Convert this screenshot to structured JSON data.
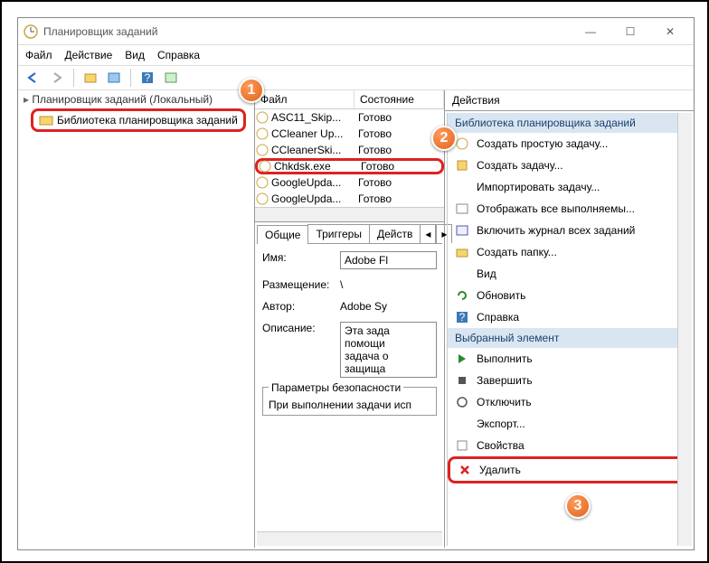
{
  "window": {
    "title": "Планировщик заданий",
    "min": "—",
    "max": "☐",
    "close": "✕"
  },
  "menu": {
    "file": "Файл",
    "action": "Действие",
    "view": "Вид",
    "help": "Справка"
  },
  "tree": {
    "root": "Планировщик заданий (Локальный)",
    "lib": "Библиотека планировщика заданий"
  },
  "tasks": {
    "col_file": "Файл",
    "col_status": "Состояние",
    "rows": [
      {
        "name": "ASC11_Skip...",
        "status": "Готово"
      },
      {
        "name": "CCleaner Up...",
        "status": "Готово"
      },
      {
        "name": "CCleanerSki...",
        "status": "Готово"
      },
      {
        "name": "Chkdsk.exe",
        "status": "Готово"
      },
      {
        "name": "GoogleUpda...",
        "status": "Готово"
      },
      {
        "name": "GoogleUpda...",
        "status": "Готово"
      }
    ]
  },
  "details": {
    "tab_general": "Общие",
    "tab_triggers": "Триггеры",
    "tab_actions": "Действ",
    "lbl_name": "Имя:",
    "val_name": "Adobe Fl",
    "lbl_location": "Размещение:",
    "val_location": "\\",
    "lbl_author": "Автор:",
    "val_author": "Adobe Sy",
    "lbl_desc": "Описание:",
    "val_desc": "Эта зада\nпомощи\nзадача о\nзащища",
    "grp_security": "Параметры безопасности",
    "txt_runas": "При выполнении задачи исп"
  },
  "actions": {
    "title": "Действия",
    "section1": "Библиотека планировщика заданий",
    "items1": [
      "Создать простую задачу...",
      "Создать задачу...",
      "Импортировать задачу...",
      "Отображать все выполняемы...",
      "Включить журнал всех заданий",
      "Создать папку...",
      "Вид",
      "Обновить",
      "Справка"
    ],
    "section2": "Выбранный элемент",
    "items2": [
      "Выполнить",
      "Завершить",
      "Отключить",
      "Экспорт...",
      "Свойства",
      "Удалить"
    ]
  },
  "badges": {
    "b1": "1",
    "b2": "2",
    "b3": "3"
  }
}
